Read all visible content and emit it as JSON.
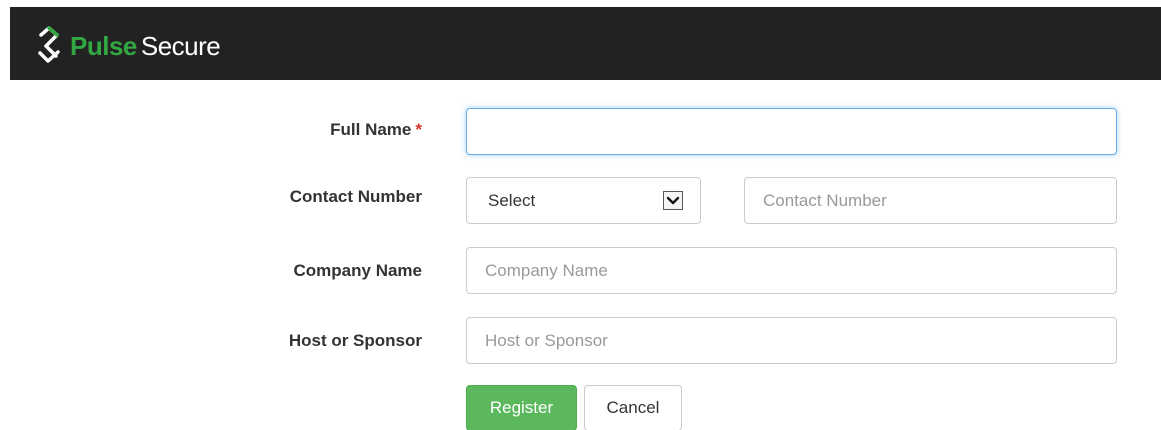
{
  "brand": {
    "name_part1": "Pulse",
    "name_part2": "Secure",
    "accent": "#33a842",
    "header_bg": "#222222",
    "icon": "pulse-s-logo"
  },
  "form": {
    "full_name": {
      "label": "Full Name",
      "required_mark": "*",
      "value": "",
      "placeholder": ""
    },
    "contact_number": {
      "label": "Contact Number",
      "select_value": "Select",
      "value": "",
      "placeholder": "Contact Number"
    },
    "company_name": {
      "label": "Company Name",
      "value": "",
      "placeholder": "Company Name"
    },
    "host_or_sponsor": {
      "label": "Host or Sponsor",
      "value": "",
      "placeholder": "Host or Sponsor"
    }
  },
  "actions": {
    "register_label": "Register",
    "register_color": "#5cb85c",
    "cancel_label": "Cancel"
  }
}
